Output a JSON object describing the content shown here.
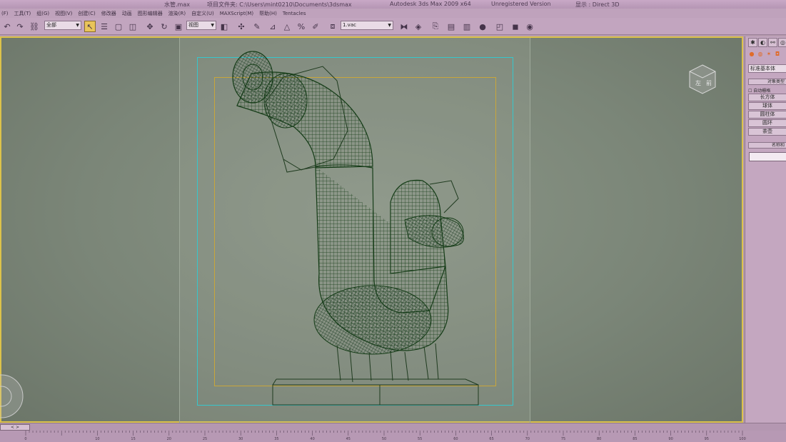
{
  "titlebar": {
    "file": "水管.max",
    "project": "项目文件夹: C:\\Users\\mint0210\\Documents\\3dsmax",
    "app": "Autodesk 3ds Max  2009 x64",
    "license": "Unregistered Version",
    "display": "显示 : Direct 3D"
  },
  "menu": [
    "(F)",
    "工具(T)",
    "组(G)",
    "视图(V)",
    "创建(C)",
    "修改器",
    "动画",
    "图形编辑器",
    "渲染(R)",
    "自定义(U)",
    "MAXScript(M)",
    "帮助(H)",
    "Tentacles"
  ],
  "toolbar": {
    "selection_set": "全部",
    "ref_coord": "视图",
    "named_sel": "1.vac"
  },
  "viewport": {
    "viewcube_label": "左",
    "viewcube_side": "前"
  },
  "command_panel": {
    "category": "标准基本体",
    "rollout_object_type": "对象类型",
    "autogrid": "自动栅格",
    "buttons": [
      "长方体",
      "球体",
      "圆柱体",
      "圆环",
      "茶壶"
    ],
    "rollout_name_color": "名称和"
  },
  "timeline": {
    "ticks": [
      "0",
      "10",
      "15",
      "20",
      "25",
      "30",
      "35",
      "40",
      "45",
      "50",
      "55",
      "60",
      "65",
      "70",
      "75",
      "80",
      "85",
      "90",
      "95",
      "100"
    ]
  }
}
